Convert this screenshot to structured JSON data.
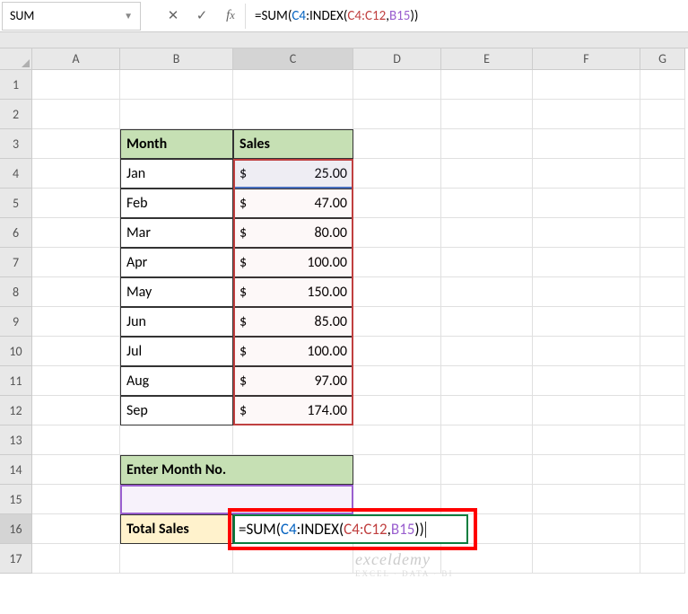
{
  "namebox": "SUM",
  "formula_bar": {
    "eq": "=",
    "fn": "SUM",
    "p1": "(",
    "r1": "C4",
    "colon": ":",
    "idx": "INDEX",
    "p2": "(",
    "r2": "C4:C12",
    "comma": ",",
    "r3": "B15",
    "p3": ")",
    "p4": ")"
  },
  "cols": {
    "A": "A",
    "B": "B",
    "C": "C",
    "D": "D",
    "E": "E",
    "F": "F",
    "G": "G"
  },
  "rows": [
    "1",
    "2",
    "3",
    "4",
    "5",
    "6",
    "7",
    "8",
    "9",
    "10",
    "11",
    "12",
    "13",
    "14",
    "15",
    "16",
    "17"
  ],
  "headers": {
    "month": "Month",
    "sales": "Sales",
    "enter": "Enter Month No.",
    "total": "Total Sales"
  },
  "data": [
    {
      "m": "Jan",
      "s": "25.00"
    },
    {
      "m": "Feb",
      "s": "47.00"
    },
    {
      "m": "Mar",
      "s": "80.00"
    },
    {
      "m": "Apr",
      "s": "100.00"
    },
    {
      "m": "May",
      "s": "150.00"
    },
    {
      "m": "Jun",
      "s": "85.00"
    },
    {
      "m": "Jul",
      "s": "100.00"
    },
    {
      "m": "Aug",
      "s": "97.00"
    },
    {
      "m": "Sep",
      "s": "174.00"
    }
  ],
  "dollar": "$",
  "watermark": {
    "main": "exceldemy",
    "sub": "EXCEL · DATA · BI"
  },
  "colwidths": {
    "A": 98,
    "B": 126,
    "C": 134,
    "D": 98,
    "E": 102,
    "F": 120,
    "G": 50
  },
  "edit_formula": {
    "eq": "=",
    "fn": "SUM",
    "p1": "(",
    "r1": "C4",
    "colon": ":",
    "idx": "INDEX",
    "p2": "(",
    "r2": "C4:C12",
    "comma": ",",
    "r3": "B15",
    "p3": ")",
    "p4": ")"
  },
  "chart_data": {
    "type": "table",
    "categories": [
      "Jan",
      "Feb",
      "Mar",
      "Apr",
      "May",
      "Jun",
      "Jul",
      "Aug",
      "Sep"
    ],
    "values": [
      25.0,
      47.0,
      80.0,
      100.0,
      150.0,
      85.0,
      100.0,
      97.0,
      174.0
    ],
    "title": "Sales",
    "xlabel": "Month",
    "ylabel": "Sales"
  }
}
